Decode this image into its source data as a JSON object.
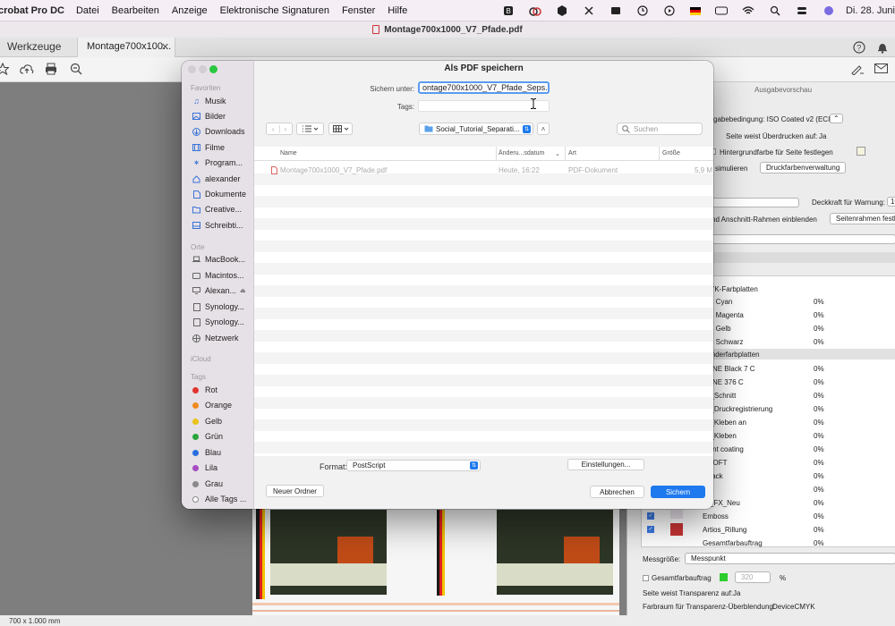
{
  "menubar": {
    "app": "crobat Pro DC",
    "items": [
      "Datei",
      "Bearbeiten",
      "Anzeige",
      "Elektronische Signaturen",
      "Fenster",
      "Hilfe"
    ],
    "clock": "Di. 28. Juni"
  },
  "window_title": "Montage700x1000_V7_Pfade.pdf",
  "tabs": {
    "tools": "Werkzeuge",
    "document": "Montage700x100..."
  },
  "statusbar": "700 x 1.000 mm",
  "dialog": {
    "title": "Als PDF speichern",
    "save_as_label": "Sichern unter:",
    "save_as_value": "ontage700x1000_V7_Pfade_Seps.ps",
    "tags_label": "Tags:",
    "folder": "Social_Tutorial_Separati...",
    "search_placeholder": "Suchen",
    "columns": {
      "name": "Name",
      "modified": "Änderu...sdatum",
      "kind": "Art",
      "size": "Größe"
    },
    "file": {
      "name": "Montage700x1000_V7_Pfade.pdf",
      "modified": "Heute, 16:22",
      "kind": "PDF-Dokument",
      "size": "5,9 M"
    },
    "format_label": "Format:",
    "format_value": "PostScript",
    "settings_button": "Einstellungen...",
    "new_folder_button": "Neuer Ordner",
    "cancel_button": "Abbrechen",
    "save_button": "Sichern"
  },
  "sidebar": {
    "favorites_heading": "Favoriten",
    "favorites": [
      {
        "label": "Musik",
        "icon": "music-icon"
      },
      {
        "label": "Bilder",
        "icon": "pictures-icon"
      },
      {
        "label": "Downloads",
        "icon": "downloads-icon"
      },
      {
        "label": "Filme",
        "icon": "movies-icon"
      },
      {
        "label": "Program...",
        "icon": "applications-icon"
      },
      {
        "label": "alexander",
        "icon": "home-icon"
      },
      {
        "label": "Dokumente",
        "icon": "documents-icon"
      },
      {
        "label": "Creative...",
        "icon": "folder-icon"
      },
      {
        "label": "Schreibti...",
        "icon": "desktop-icon"
      }
    ],
    "locations_heading": "Orte",
    "locations": [
      {
        "label": "MacBook...",
        "icon": "laptop-icon"
      },
      {
        "label": "Macintos...",
        "icon": "disk-icon"
      },
      {
        "label": "Alexan...",
        "icon": "display-icon"
      },
      {
        "label": "Synology...",
        "icon": "server-icon"
      },
      {
        "label": "Synology...",
        "icon": "server-icon"
      },
      {
        "label": "Netzwerk",
        "icon": "network-icon"
      }
    ],
    "icloud_heading": "iCloud",
    "tags_heading": "Tags",
    "tags": [
      {
        "label": "Rot",
        "color": "#e0342f"
      },
      {
        "label": "Orange",
        "color": "#f08a1c"
      },
      {
        "label": "Gelb",
        "color": "#e8c21a"
      },
      {
        "label": "Grün",
        "color": "#2aa63a"
      },
      {
        "label": "Blau",
        "color": "#2a6fe0"
      },
      {
        "label": "Lila",
        "color": "#a64cc2"
      },
      {
        "label": "Grau",
        "color": "#8a8a8a"
      },
      {
        "label": "Alle Tags ...",
        "color": ""
      }
    ]
  },
  "panel": {
    "heading": "Ausgabevorschau",
    "output_condition": "sgabebedingung: ISO Coated v2 (ECI)",
    "overprint_label": "Seite weist Überdrucken auf:",
    "overprint_value": "Ja",
    "bg_color_label": "Hintergrundfarbe für Seite festlegen",
    "simulate": "simulieren",
    "ink_manager_button": "Druckfarbenverwaltung",
    "opacity_warning_label": "Deckkraft für Warnung:",
    "opacity_warning_value": "10",
    "show_bleed": "nd Anschnitt-Rahmen einblenden",
    "set_page_frames_button": "Seitenrahmen festl",
    "process_plates": "YK-Farbplatten",
    "spot_plates": "Sonderfarbplatten",
    "plates": [
      {
        "name": "ess Cyan",
        "pct": "0%"
      },
      {
        "name": "ess Magenta",
        "pct": "0%"
      },
      {
        "name": "ess Gelb",
        "pct": "0%"
      },
      {
        "name": "ess Schwarz",
        "pct": "0%"
      },
      {
        "name": "TONE Black 7 C",
        "pct": "0%"
      },
      {
        "name": "TONE 376 C",
        "pct": "0%"
      },
      {
        "name": "os_Schnitt",
        "pct": "0%"
      },
      {
        "name": "os_Druckregistrierung",
        "pct": "0%"
      },
      {
        "name": "os_Kleben an",
        "pct": "0%"
      },
      {
        "name": "os_Kleben",
        "pct": "0%"
      },
      {
        "name": "ment coating",
        "pct": "0%"
      },
      {
        "name": "OSOFT",
        "pct": "0%"
      },
      {
        "name": "nzlack",
        "pct": "0%"
      },
      {
        "name": "foil",
        "pct": "0%"
      },
      {
        "name": "ial_FX_Neu",
        "pct": "0%"
      },
      {
        "name": "Emboss",
        "pct": "0%"
      },
      {
        "name": "Artios_Rillung",
        "pct": "0%"
      },
      {
        "name": "Gesamtfarbauftrag",
        "pct": "0%"
      }
    ],
    "sample_size_label": "Messgröße:",
    "sample_size_value": "Messpunkt",
    "total_ink_label": "Gesamtfarbauftrag",
    "total_ink_value": "320",
    "total_ink_unit": "%",
    "transparency_label": "Seite weist Transparenz auf:",
    "transparency_value": "Ja",
    "blend_label": "Farbraum für Transparenz-Überblendung:",
    "blend_value": "DeviceCMYK"
  },
  "colors": {
    "accent": "#1e79ee"
  }
}
